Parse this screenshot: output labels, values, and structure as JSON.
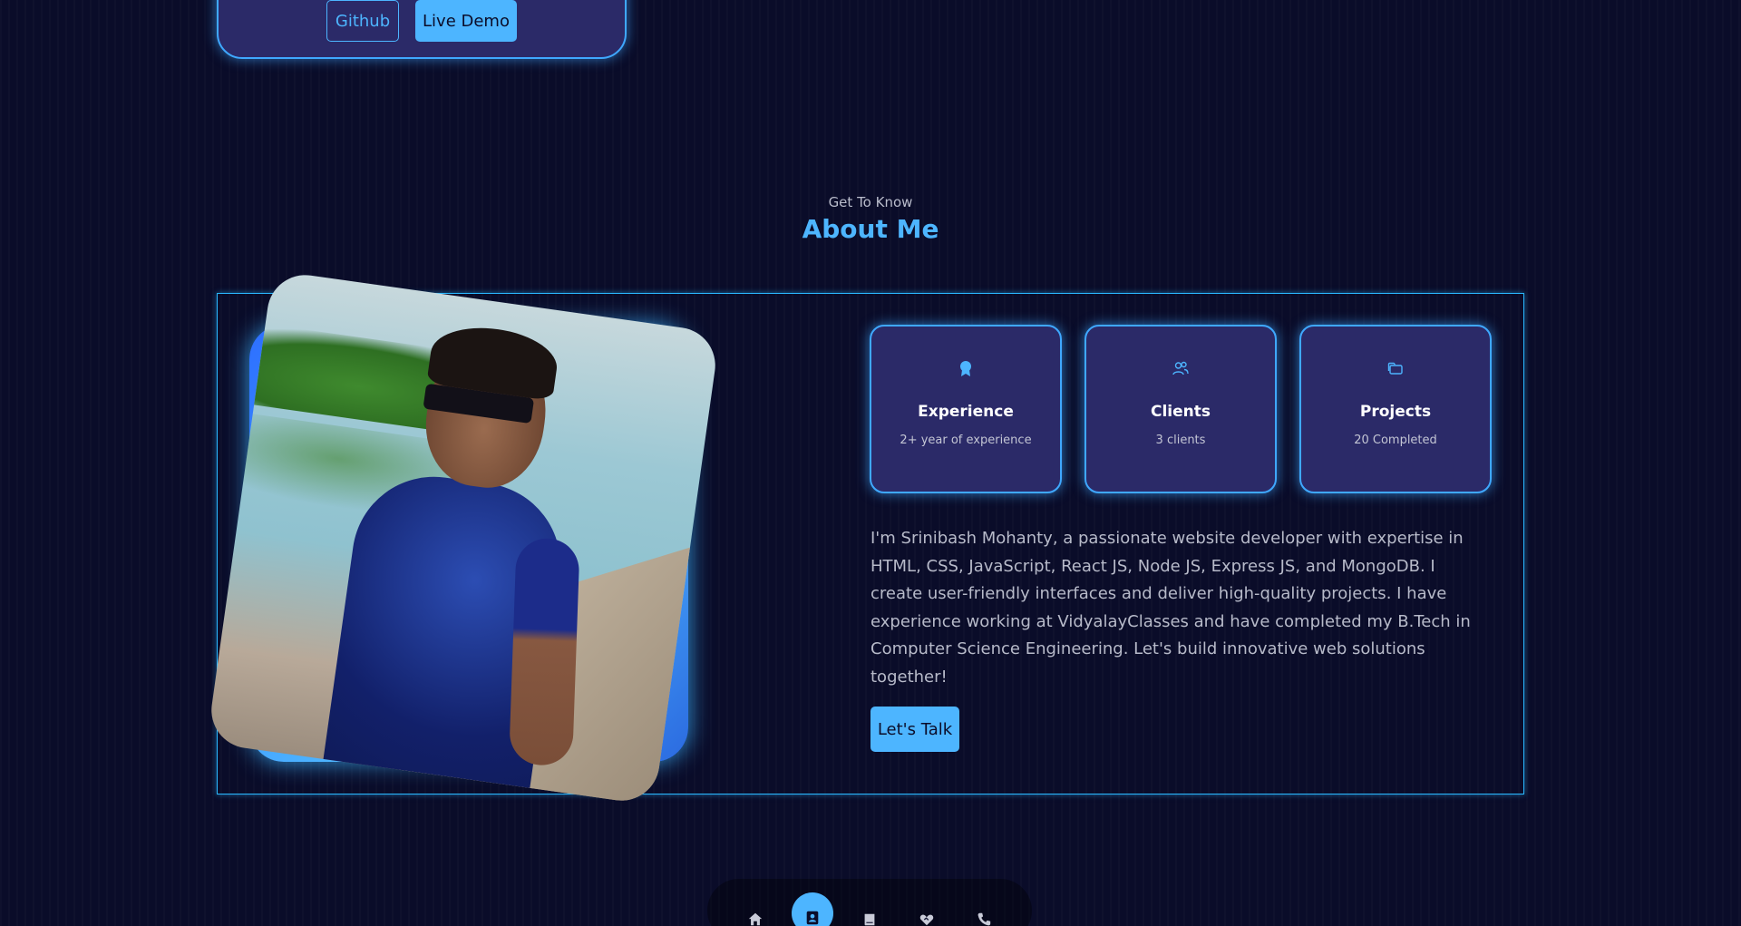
{
  "project_card": {
    "github_label": "Github",
    "demo_label": "Live Demo"
  },
  "about": {
    "subtitle": "Get To Know",
    "title": "About Me",
    "cards": [
      {
        "icon": "award-icon",
        "title": "Experience",
        "subtitle": "2+ year of experience"
      },
      {
        "icon": "users-icon",
        "title": "Clients",
        "subtitle": "3 clients"
      },
      {
        "icon": "folder-icon",
        "title": "Projects",
        "subtitle": "20 Completed"
      }
    ],
    "bio": "I'm Srinibash Mohanty, a passionate website developer with expertise in HTML, CSS, JavaScript, React JS, Node JS, Express JS, and MongoDB. I create user-friendly interfaces and deliver high-quality projects. I have experience working at VidyalayClasses and have completed my B.Tech in Computer Science Engineering. Let's build innovative web solutions together!",
    "cta_label": "Let's Talk"
  },
  "nav": {
    "items": [
      "home-icon",
      "user-icon",
      "book-icon",
      "services-icon",
      "phone-icon"
    ],
    "active": "user-icon"
  },
  "colors": {
    "background": "#0a0c29",
    "accent": "#4db5ff",
    "card": "#2b2a68"
  }
}
